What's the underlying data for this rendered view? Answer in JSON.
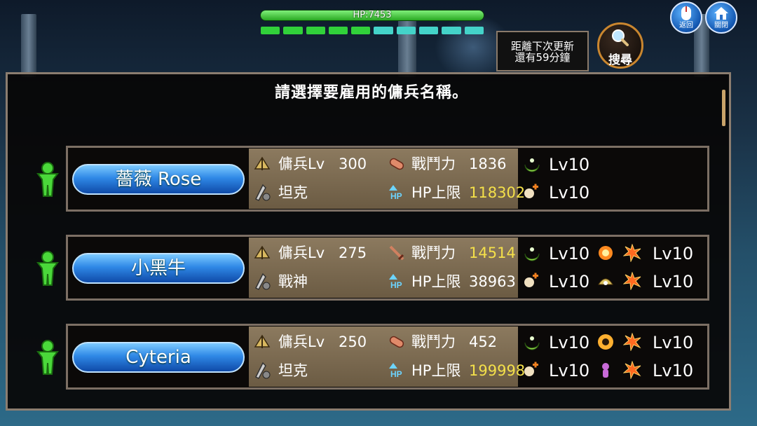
{
  "hud": {
    "hp_text": "HP:7453",
    "segments": [
      "#31d13a",
      "#31d13a",
      "#31d13a",
      "#31d13a",
      "#31d13a",
      "#44d3c9",
      "#44d3c9",
      "#44d3c9",
      "#44d3c9",
      "#44d3c9"
    ]
  },
  "update": {
    "line1": "距離下次更新",
    "line2": "還有59分鐘"
  },
  "search": {
    "label": "搜尋"
  },
  "back": {
    "label": "返回"
  },
  "close": {
    "label": "關閉"
  },
  "panel": {
    "title": "請選擇要雇用的傭兵名稱。"
  },
  "mercenaries": [
    {
      "name": "薔薇 Rose",
      "level_label": "傭兵Lv",
      "level": "300",
      "role": "坦克",
      "power_label": "戰鬥力",
      "power": "1836",
      "hp_label": "HP上限",
      "hp": "118302",
      "skills": [
        {
          "icon": "crescent-skill-icon",
          "lv": "Lv10"
        },
        {
          "icon": "heal-skill-icon",
          "lv": "Lv10"
        }
      ]
    },
    {
      "name": "小黑牛",
      "level_label": "傭兵Lv",
      "level": "275",
      "role": "戰神",
      "power_label": "戰鬥力",
      "power": "14514",
      "hp_label": "HP上限",
      "hp": "38963",
      "skills": [
        {
          "icon": "crescent-skill-icon",
          "lv": "Lv10"
        },
        {
          "icon": "heal-skill-icon",
          "lv": "Lv10"
        },
        {
          "icon": "fire-burst-skill-icon",
          "lv": "Lv10"
        },
        {
          "icon": "shield-burst-skill-icon",
          "lv": "Lv10"
        }
      ]
    },
    {
      "name": "Cyteria",
      "level_label": "傭兵Lv",
      "level": "250",
      "role": "坦克",
      "power_label": "戰鬥力",
      "power": "452",
      "hp_label": "HP上限",
      "hp": "199998",
      "skills": [
        {
          "icon": "crescent-skill-icon",
          "lv": "Lv10"
        },
        {
          "icon": "heal-skill-icon",
          "lv": "Lv10"
        },
        {
          "icon": "sun-burst-skill-icon",
          "lv": "Lv10"
        },
        {
          "icon": "poison-skill-icon",
          "lv": "Lv10"
        }
      ]
    }
  ]
}
